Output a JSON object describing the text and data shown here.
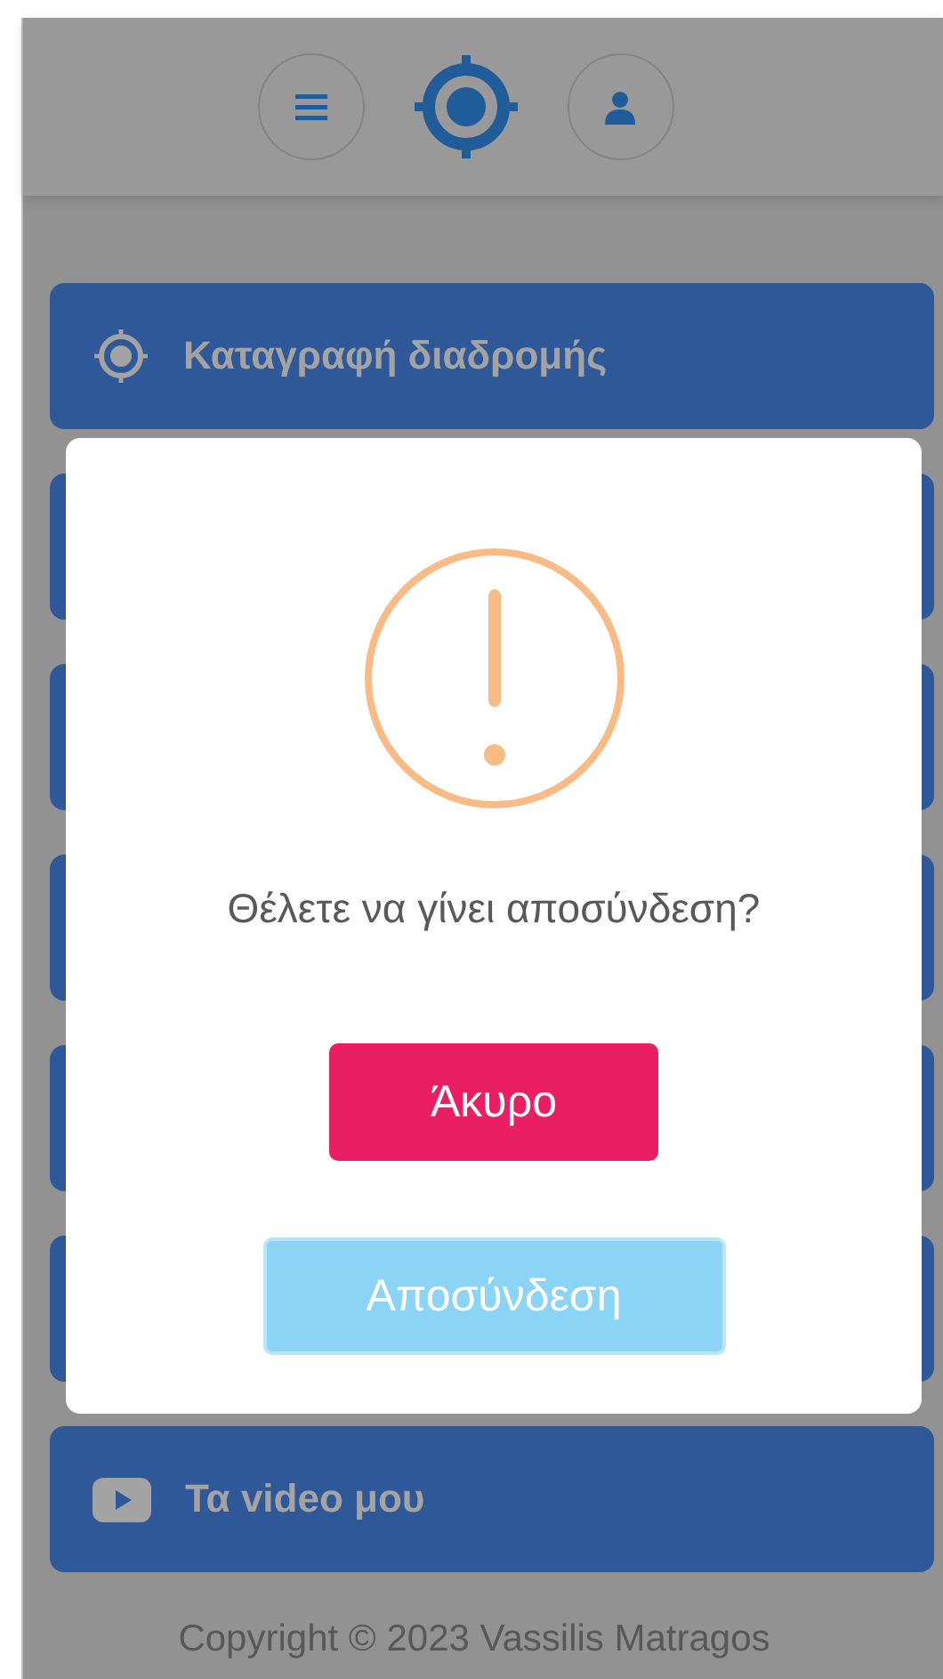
{
  "header": {
    "buttons": [
      {
        "kind": "menu"
      },
      {
        "kind": "logo"
      },
      {
        "kind": "profile"
      }
    ]
  },
  "menu_items": [
    {
      "kind": "target",
      "label": "Καταγραφή διαδρομής"
    },
    {
      "kind": "hidden"
    },
    {
      "kind": "hidden"
    },
    {
      "kind": "hidden"
    },
    {
      "kind": "hidden"
    },
    {
      "kind": "hidden"
    },
    {
      "kind": "video",
      "label": "Τα video μου"
    }
  ],
  "footer": {
    "copyright": "Copyright © 2023 Vassilis Matragos"
  },
  "dialog": {
    "kind": "warning",
    "message": "Θέλετε να γίνει αποσύνδεση?",
    "buttons": [
      {
        "kind": "cancel",
        "label": "Άκυρο"
      },
      {
        "kind": "confirm",
        "label": "Αποσύνδεση"
      }
    ]
  }
}
